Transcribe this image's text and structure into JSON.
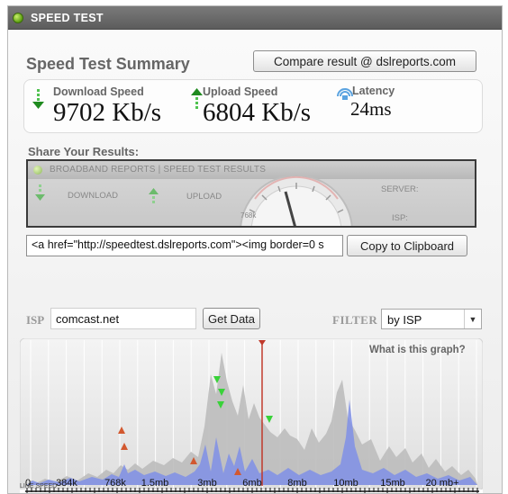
{
  "window": {
    "title": "SPEED TEST"
  },
  "summary": {
    "title": "Speed Test Summary",
    "compare_button": "Compare result @ dslreports.com",
    "download": {
      "label": "Download Speed",
      "value": "9702 Kb/s"
    },
    "upload": {
      "label": "Upload Speed",
      "value": "6804 Kb/s"
    },
    "latency": {
      "label": "Latency",
      "value": "24ms"
    }
  },
  "share": {
    "label": "Share Your Results:",
    "banner": {
      "title": "BROADBAND REPORTS | SPEED TEST RESULTS",
      "download": "DOWNLOAD",
      "upload": "UPLOAD",
      "server": "SERVER:",
      "isp": "ISP:",
      "gauge_tick": "768k"
    },
    "embed_code": "<a href=\"http://speedtest.dslreports.com\"><img border=0 s",
    "copy_button": "Copy to Clipboard"
  },
  "isp_filter": {
    "isp_label": "ISP",
    "isp_value": "comcast.net",
    "get_data_button": "Get Data",
    "filter_label": "FILTER",
    "filter_value": "by ISP"
  },
  "graph": {
    "help_link": "What is this graph?",
    "axis_labels": [
      "0",
      "384k",
      "768k",
      "1.5mb",
      "3mb",
      "6mb",
      "8mb",
      "10mb",
      "15mb",
      "20 mb+"
    ],
    "bottom_label": "LINE SPEED",
    "colors": {
      "gray_area": "#bdbdbd",
      "blue_area": "#8a99e6",
      "marker_line": "#c0392b",
      "download_marker": "#39d239",
      "upload_marker": "#d2582f"
    }
  }
}
